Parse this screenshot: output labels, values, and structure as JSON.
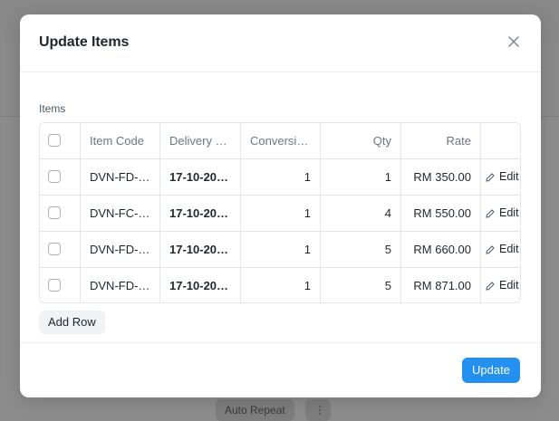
{
  "background": {
    "buttons": [
      "Auto Repeat",
      "⋮"
    ]
  },
  "dialog": {
    "title": "Update Items",
    "close_icon": "close-icon",
    "section_label": "Items",
    "columns": [
      "Item Code",
      "Delivery …",
      "Conversi…",
      "Qty",
      "Rate"
    ],
    "rows": [
      {
        "item_code": "DVN-FD-…",
        "delivery": "17-10-20…",
        "conversion": "1",
        "qty": "1",
        "rate": "RM 350.00",
        "edit": "Edit"
      },
      {
        "item_code": "DVN-FC-…",
        "delivery": "17-10-20…",
        "conversion": "1",
        "qty": "4",
        "rate": "RM 550.00",
        "edit": "Edit"
      },
      {
        "item_code": "DVN-FD-…",
        "delivery": "17-10-20…",
        "conversion": "1",
        "qty": "5",
        "rate": "RM 660.00",
        "edit": "Edit"
      },
      {
        "item_code": "DVN-FD-…",
        "delivery": "17-10-20…",
        "conversion": "1",
        "qty": "5",
        "rate": "RM 871.00",
        "edit": "Edit"
      }
    ],
    "add_row_label": "Add Row",
    "update_label": "Update"
  },
  "colors": {
    "primary": "#2490ef",
    "overlay": "#8c8c8c",
    "border": "#e2e6e9"
  }
}
